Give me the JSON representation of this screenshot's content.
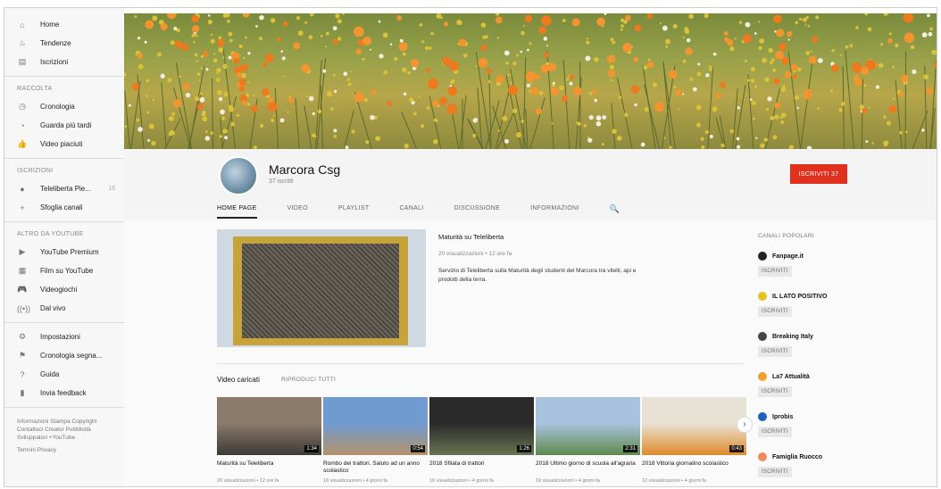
{
  "sidebar": {
    "top": [
      {
        "label": "Home",
        "icon": "home-icon",
        "glyph": "⌂"
      },
      {
        "label": "Tendenze",
        "icon": "flame-icon",
        "glyph": "♨"
      },
      {
        "label": "Iscrizioni",
        "icon": "subscriptions-icon",
        "glyph": "▤"
      }
    ],
    "collection_head": "RACCOLTA",
    "collection": [
      {
        "label": "Cronologia",
        "icon": "history-icon",
        "glyph": "◷"
      },
      {
        "label": "Guarda più tardi",
        "icon": "clock-icon",
        "glyph": "◔"
      },
      {
        "label": "Video piaciuti",
        "icon": "thumb-up-icon",
        "glyph": "👍"
      }
    ],
    "subs_head": "ISCRIZIONI",
    "subs": [
      {
        "label": "Teleliberta Pie...",
        "icon": "channel-avatar-icon",
        "glyph": "●",
        "count": "16"
      },
      {
        "label": "Sfoglia canali",
        "icon": "plus-icon",
        "glyph": "+"
      }
    ],
    "more_head": "ALTRO DA YOUTUBE",
    "more": [
      {
        "label": "YouTube Premium",
        "icon": "youtube-premium-icon",
        "glyph": "▶"
      },
      {
        "label": "Film su YouTube",
        "icon": "film-icon",
        "glyph": "▦"
      },
      {
        "label": "Videogiochi",
        "icon": "gamepad-icon",
        "glyph": "🎮"
      },
      {
        "label": "Dal vivo",
        "icon": "live-icon",
        "glyph": "((•))"
      }
    ],
    "settings": [
      {
        "label": "Impostazioni",
        "icon": "gear-icon",
        "glyph": "⚙"
      },
      {
        "label": "Cronologia segna...",
        "icon": "flag-icon",
        "glyph": "⚑"
      },
      {
        "label": "Guida",
        "icon": "help-icon",
        "glyph": "?"
      },
      {
        "label": "Invia feedback",
        "icon": "feedback-icon",
        "glyph": "▮"
      }
    ],
    "footer": "Informazioni Stampa Copyright Contattaci Creator Pubblicità Sviluppatori +YouTube",
    "footer2": "Termini Privacy"
  },
  "channel": {
    "name": "Marcora Csg",
    "subscribers": "37 iscritti",
    "subscribe_label": "ISCRIVITI 37"
  },
  "tabs": [
    {
      "label": "HOME PAGE",
      "active": true
    },
    {
      "label": "VIDEO",
      "active": false
    },
    {
      "label": "PLAYLIST",
      "active": false
    },
    {
      "label": "CANALI",
      "active": false
    },
    {
      "label": "DISCUSSIONE",
      "active": false
    },
    {
      "label": "INFORMAZIONI",
      "active": false
    }
  ],
  "featured": {
    "title": "Maturità su Teleliberta",
    "meta": "20 visualizzazioni • 12 ore fa",
    "description": "Servizio di Teleliberta sulla Maturità degli studenti del Marcora tra vitelli, api e prodotti della terra."
  },
  "uploads": {
    "title": "Video caricati",
    "play_all": "RIPRODUCI TUTTI",
    "videos": [
      {
        "title": "Maturità su Teleliberta",
        "meta": "20 visualizzazioni • 12 ore fa",
        "duration": "1:34",
        "colors": [
          "#8b7b6a",
          "#3c3a36"
        ]
      },
      {
        "title": "Rombo dei trattori. Saluto ad un anno scolastico",
        "meta": "18 visualizzazioni • 4 giorni fa",
        "duration": "0:54",
        "colors": [
          "#6f9bd0",
          "#b4926a"
        ]
      },
      {
        "title": "2018 Sfilata di trattori",
        "meta": "16 visualizzazioni • 4 giorni fa",
        "duration": "1:26",
        "colors": [
          "#2a2a2a",
          "#6a7350"
        ]
      },
      {
        "title": "2018 Ultimo giorno di scuola all'agraria",
        "meta": "19 visualizzazioni • 4 giorni fa",
        "duration": "2:31",
        "colors": [
          "#a9c3de",
          "#5f8a4f"
        ]
      },
      {
        "title": "2018 Vittoria giornalino scolastico",
        "meta": "12 visualizzazioni • 4 giorni fa",
        "duration": "0:43",
        "colors": [
          "#e8e2d5",
          "#e08a2a"
        ]
      }
    ]
  },
  "popular": {
    "title": "CANALI POPOLARI",
    "subscribe_label": "ISCRIVITI",
    "channels": [
      {
        "name": "Fanpage.it",
        "color": "#222222"
      },
      {
        "name": "IL LATO POSITIVO",
        "color": "#e6c21f"
      },
      {
        "name": "Breaking Italy",
        "color": "#444444"
      },
      {
        "name": "La7 Attualità",
        "color": "#f0a030"
      },
      {
        "name": "Iprobis",
        "color": "#1f5fbf"
      },
      {
        "name": "Famiglia Ruocco",
        "color": "#f08a5a"
      }
    ]
  },
  "colors": {
    "accent": "#e0311f"
  }
}
